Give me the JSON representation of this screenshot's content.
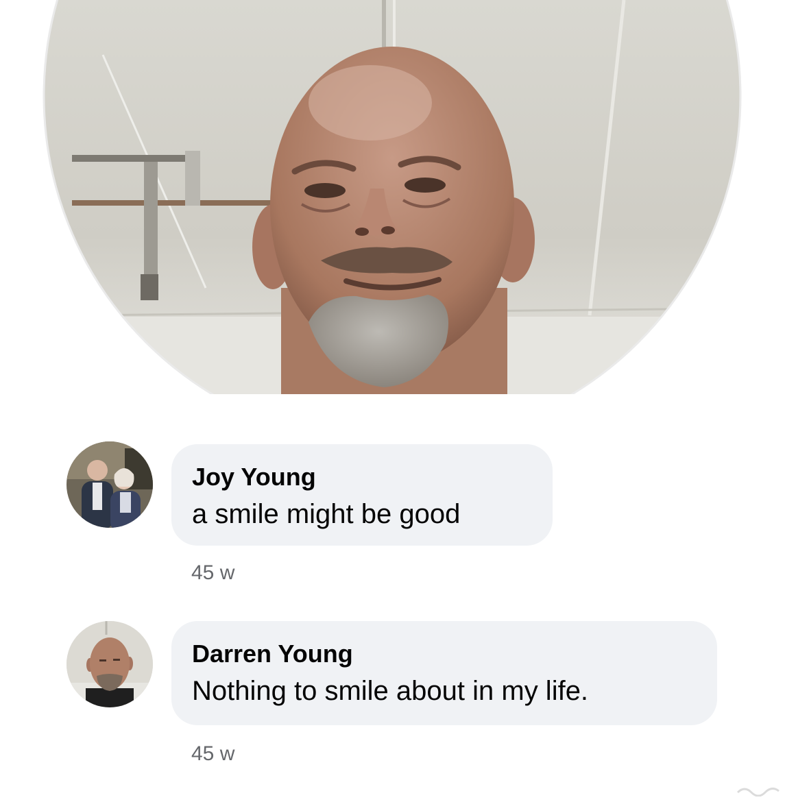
{
  "post": {
    "photo_icon": "profile-photo"
  },
  "comments": [
    {
      "author": "Joy Young",
      "text": "a smile might be good",
      "timestamp": "45 w",
      "avatar_icon": "couple-photo-avatar"
    },
    {
      "author": "Darren Young",
      "text": "Nothing to smile about in my life.",
      "timestamp": "45 w",
      "avatar_icon": "man-photo-avatar"
    }
  ],
  "colors": {
    "bubble_bg": "#f0f2f5",
    "author_text": "#050505",
    "timestamp_text": "#65676b",
    "page_bg": "#ffffff"
  }
}
